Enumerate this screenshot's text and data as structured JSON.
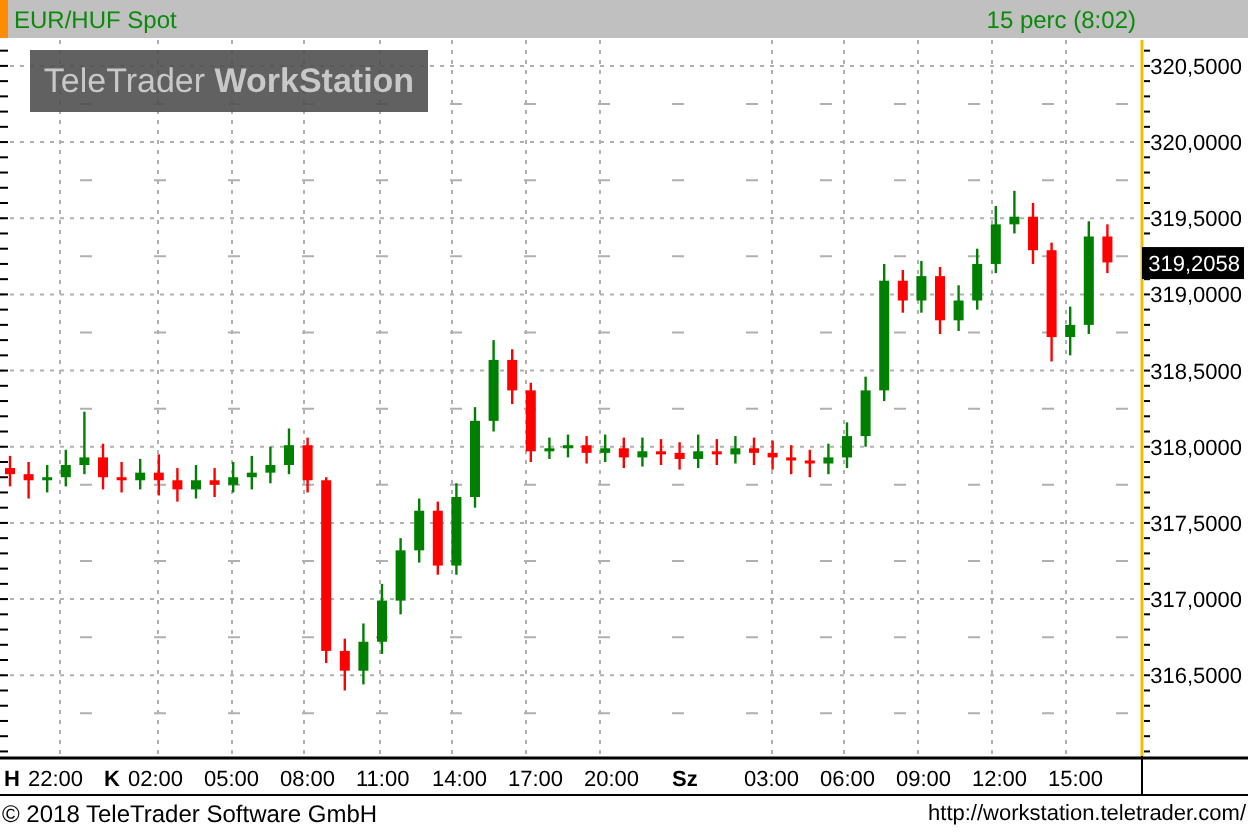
{
  "header": {
    "symbol": "EUR/HUF Spot",
    "interval": "15 perc (8:02)"
  },
  "logo": "TeleTrader **WorkStation**",
  "chart": {
    "last_price": "319,2058",
    "y_axis_labels": [
      "320,5000",
      "320,0000",
      "319,5000",
      "319,0000",
      "318,5000",
      "318,0000",
      "317,5000",
      "317,0000",
      "316,5000"
    ],
    "x_axis_labels": [
      {
        "kind": "day",
        "text": "H"
      },
      {
        "kind": "time",
        "text": "22:00"
      },
      {
        "kind": "day",
        "text": "K"
      },
      {
        "kind": "time",
        "text": "02:00"
      },
      {
        "kind": "time",
        "text": "05:00"
      },
      {
        "kind": "time",
        "text": "08:00"
      },
      {
        "kind": "time",
        "text": "11:00"
      },
      {
        "kind": "time",
        "text": "14:00"
      },
      {
        "kind": "time",
        "text": "17:00"
      },
      {
        "kind": "time",
        "text": "20:00"
      },
      {
        "kind": "day",
        "text": "Sz"
      },
      {
        "kind": "time",
        "text": "03:00"
      },
      {
        "kind": "time",
        "text": "06:00"
      },
      {
        "kind": "time",
        "text": "09:00"
      },
      {
        "kind": "time",
        "text": "12:00"
      },
      {
        "kind": "time",
        "text": "15:00"
      }
    ]
  },
  "footer": {
    "copyright": "© 2018 TeleTrader Software GmbH",
    "link": "http://workstation.teletrader.com/"
  }
}
